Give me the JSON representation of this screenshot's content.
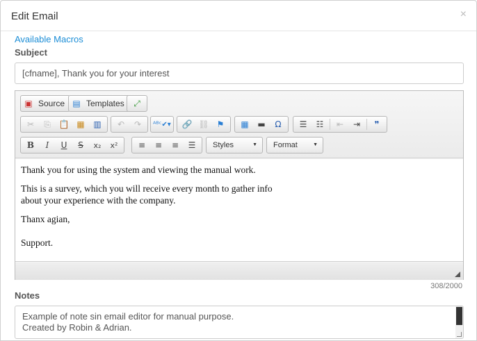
{
  "modal": {
    "title": "Edit Email",
    "close_glyph": "×"
  },
  "macros_link": "Available Macros",
  "subject": {
    "label": "Subject",
    "value": "[cfname], Thank you for your interest"
  },
  "editor": {
    "toolbar": {
      "source_label": "Source",
      "templates_label": "Templates",
      "styles_label": "Styles",
      "format_label": "Format"
    },
    "content": {
      "p1": "Thank you for using the system and viewing the manual work.",
      "p2_line1": "This is a survey, which you will receive every month to gather info",
      "p2_line2": "about your experience with the company.",
      "p3": "Thanx agian,",
      "p4": "Support."
    },
    "char_count": "308/2000"
  },
  "notes": {
    "label": "Notes",
    "line1": "Example of note sin email editor for manual purpose.",
    "line2": "Created by Robin & Adrian."
  },
  "colors": {
    "link": "#1b8dd6",
    "label": "#555555",
    "border": "#cccccc"
  }
}
